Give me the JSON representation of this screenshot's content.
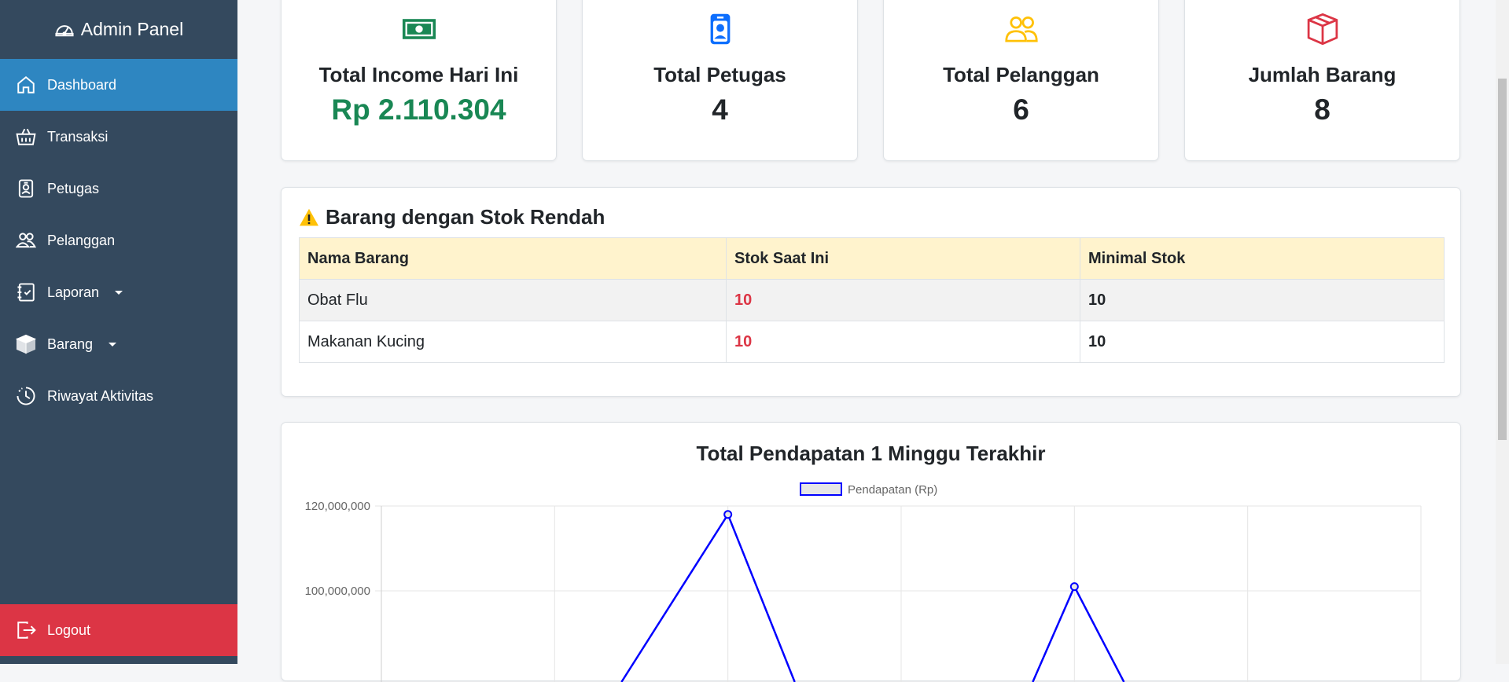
{
  "app": {
    "title": "Admin Panel"
  },
  "sidebar": {
    "items": [
      {
        "label": "Dashboard",
        "icon": "home-icon",
        "active": true
      },
      {
        "label": "Transaksi",
        "icon": "basket-icon"
      },
      {
        "label": "Petugas",
        "icon": "person-badge-icon"
      },
      {
        "label": "Pelanggan",
        "icon": "people-icon"
      },
      {
        "label": "Laporan",
        "icon": "journal-check-icon",
        "dropdown": true
      },
      {
        "label": "Barang",
        "icon": "box-icon",
        "dropdown": true
      },
      {
        "label": "Riwayat Aktivitas",
        "icon": "clock-history-icon"
      }
    ],
    "logout_label": "Logout"
  },
  "stats": [
    {
      "label": "Total Income Hari Ini",
      "value": "Rp 2.110.304",
      "icon": "cash-icon",
      "color": "#198754"
    },
    {
      "label": "Total Petugas",
      "value": "4",
      "icon": "person-badge-icon",
      "color": "#0d6efd"
    },
    {
      "label": "Total Pelanggan",
      "value": "6",
      "icon": "people-icon",
      "color": "#ffc107"
    },
    {
      "label": "Jumlah Barang",
      "value": "8",
      "icon": "box-icon",
      "color": "#dc3545"
    }
  ],
  "low_stock": {
    "title": "Barang dengan Stok Rendah",
    "columns": [
      "Nama Barang",
      "Stok Saat Ini",
      "Minimal Stok"
    ],
    "rows": [
      {
        "name": "Obat Flu",
        "stock": "10",
        "min": "10"
      },
      {
        "name": "Makanan Kucing",
        "stock": "10",
        "min": "10"
      }
    ]
  },
  "chart_data": {
    "type": "line",
    "title": "Total Pendapatan 1 Minggu Terakhir",
    "series": [
      {
        "name": "Pendapatan (Rp)",
        "color": "#0000ff",
        "values": [
          null,
          null,
          118000000,
          null,
          101000000,
          null,
          null
        ]
      }
    ],
    "y_tick_labels": [
      "120,000,000",
      "100,000,000"
    ],
    "ylim_visible": [
      90000000,
      120000000
    ],
    "legend_position": "top"
  },
  "colors": {
    "sidebar": "#34495e",
    "active": "#2e86c1",
    "logout": "#dc3545"
  }
}
